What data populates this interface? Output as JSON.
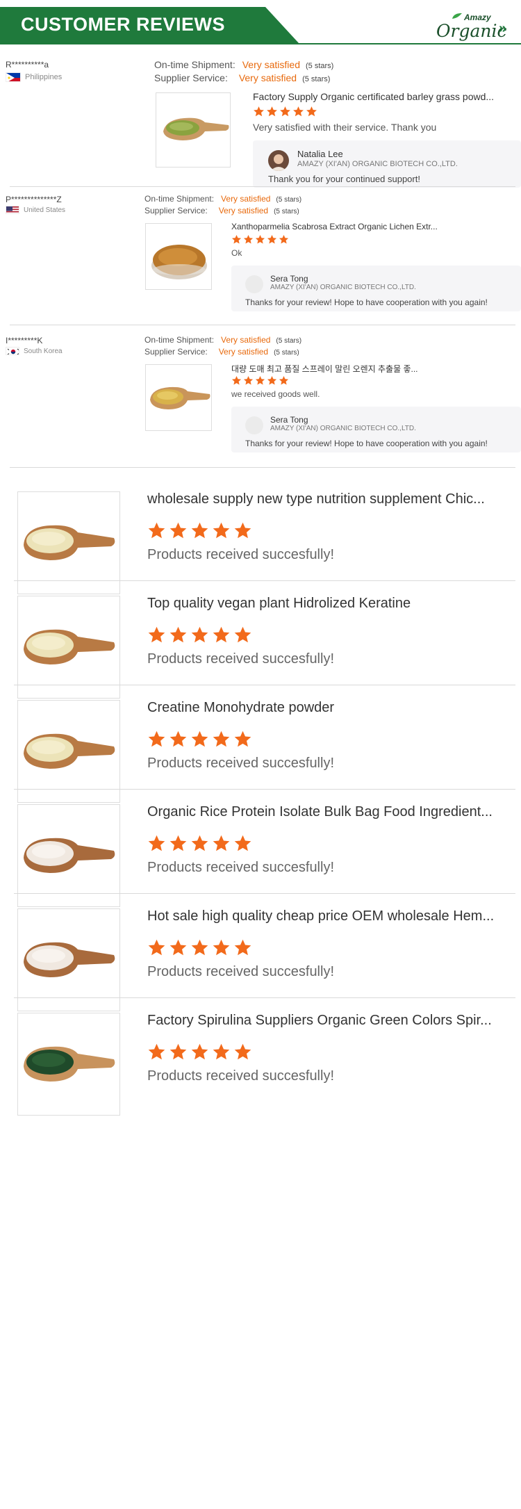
{
  "header": {
    "title": "CUSTOMER REVIEWS",
    "brand_small": "Amazy",
    "brand_big": "Organic",
    "chevrons": "»"
  },
  "colors": {
    "brand_green": "#1f7a3c",
    "accent_orange": "#e8690c",
    "star_orange": "#f26a1b"
  },
  "reviews": [
    {
      "name": "R**********a",
      "country": "Philippines",
      "shipment_label": "On-time Shipment:",
      "shipment_value": "Very satisfied",
      "shipment_stars": "(5 stars)",
      "service_label": "Supplier Service:",
      "service_value": "Very satisfied",
      "service_stars": "(5 stars)",
      "product_title": "Factory Supply Organic certificated barley grass powd...",
      "rating": 5,
      "comment": "Very satisfied with their service. Thank you",
      "reply": {
        "name": "Natalia Lee",
        "company": "AMAZY (XI'AN) ORGANIC BIOTECH CO.,LTD.",
        "text": "Thank you for your continued support!"
      }
    },
    {
      "name": "P**************Z",
      "country": "United States",
      "shipment_label": "On-time Shipment:",
      "shipment_value": "Very satisfied",
      "shipment_stars": "(5 stars)",
      "service_label": "Supplier Service:",
      "service_value": "Very satisfied",
      "service_stars": "(5 stars)",
      "product_title": "Xanthoparmelia Scabrosa Extract Organic Lichen Extr...",
      "rating": 5,
      "comment": "Ok",
      "reply": {
        "name": "Sera Tong",
        "company": "AMAZY (XI'AN) ORGANIC BIOTECH CO.,LTD.",
        "text": "Thanks for your review! Hope to have cooperation with you again!"
      }
    },
    {
      "name": "I*********K",
      "country": "South Korea",
      "shipment_label": "On-time Shipment:",
      "shipment_value": "Very satisfied",
      "shipment_stars": "(5 stars)",
      "service_label": "Supplier Service:",
      "service_value": "Very satisfied",
      "service_stars": "(5 stars)",
      "product_title": "대량 도매 최고 품질 스프레이 말린 오렌지 추출물 좋...",
      "rating": 5,
      "comment": "we received goods well.",
      "reply": {
        "name": "Sera Tong",
        "company": "AMAZY (XI'AN) ORGANIC BIOTECH CO.,LTD.",
        "text": "Thanks for your review! Hope to have cooperation with you again!"
      }
    }
  ],
  "products": [
    {
      "title": "wholesale supply new type nutrition supplement Chic...",
      "rating": 5,
      "comment": "Products received succesfully!"
    },
    {
      "title": "Top quality vegan plant Hidrolized Keratine",
      "rating": 5,
      "comment": "Products received succesfully!"
    },
    {
      "title": "Creatine Monohydrate powder",
      "rating": 5,
      "comment": "Products received succesfully!"
    },
    {
      "title": "Organic Rice Protein Isolate Bulk Bag Food Ingredient...",
      "rating": 5,
      "comment": "Products received succesfully!"
    },
    {
      "title": "Hot sale high quality cheap price OEM wholesale Hem...",
      "rating": 5,
      "comment": "Products received succesfully!"
    },
    {
      "title": "Factory Spirulina Suppliers Organic Green Colors Spir...",
      "rating": 5,
      "comment": "Products received succesfully!"
    }
  ]
}
